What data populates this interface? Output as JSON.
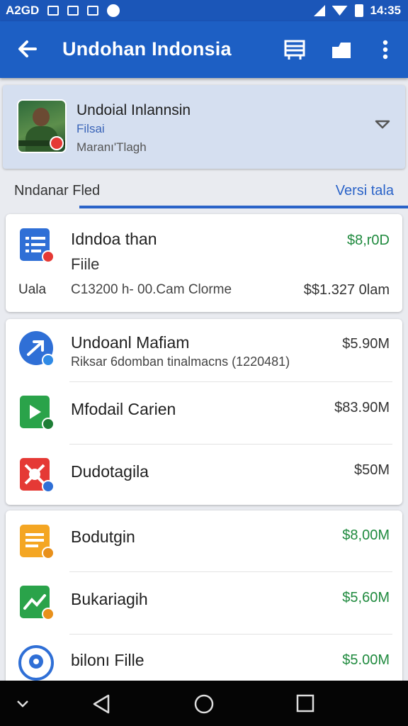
{
  "status_bar": {
    "left_text": "A2GD",
    "time": "14:35"
  },
  "app_bar": {
    "title": "Undohan Indonsia"
  },
  "profile": {
    "name": "Undoial Inlannsin",
    "subtitle": "Filsai",
    "meta": "Maranı'Tlagh"
  },
  "tabs": {
    "left": "Nndanar Fled",
    "right": "Versi tala"
  },
  "featured": {
    "title": "Idndoa than",
    "subtitle": "Fiile",
    "label": "Uala",
    "detail": "C13200 h- 00.Cam Clorme",
    "amount_top": "$8,r0D",
    "amount_bottom": "$$1.327 0lam"
  },
  "list_group_1": [
    {
      "title": "Undoanl Mafiam",
      "subtitle": "Riksar 6domban tinalmacns (1220481)",
      "amount": "$5.90M"
    },
    {
      "title": "Mfodail Carien",
      "subtitle": "",
      "amount": "$83.90M"
    },
    {
      "title": "Dudotagila",
      "subtitle": "",
      "amount": "$50M"
    }
  ],
  "list_group_2": [
    {
      "title": "Bodutgin",
      "amount": "$8,00M"
    },
    {
      "title": "Bukariagih",
      "amount": "$5,60M"
    },
    {
      "title": "bilonı Fille",
      "amount": "$5.00M"
    }
  ],
  "colors": {
    "app_bar": "#1d5fc4",
    "status_bar": "#1b56b8",
    "accent_blue": "#2a63c8",
    "money_green": "#1f8a3e"
  },
  "icons": [
    "back-arrow-icon",
    "list-view-icon",
    "folder-icon",
    "more-vert-icon",
    "chevron-down-icon",
    "document-icon",
    "send-icon",
    "video-icon",
    "tools-icon",
    "slides-icon",
    "chart-icon",
    "location-icon",
    "nav-back-icon",
    "nav-home-icon",
    "nav-recents-icon"
  ]
}
